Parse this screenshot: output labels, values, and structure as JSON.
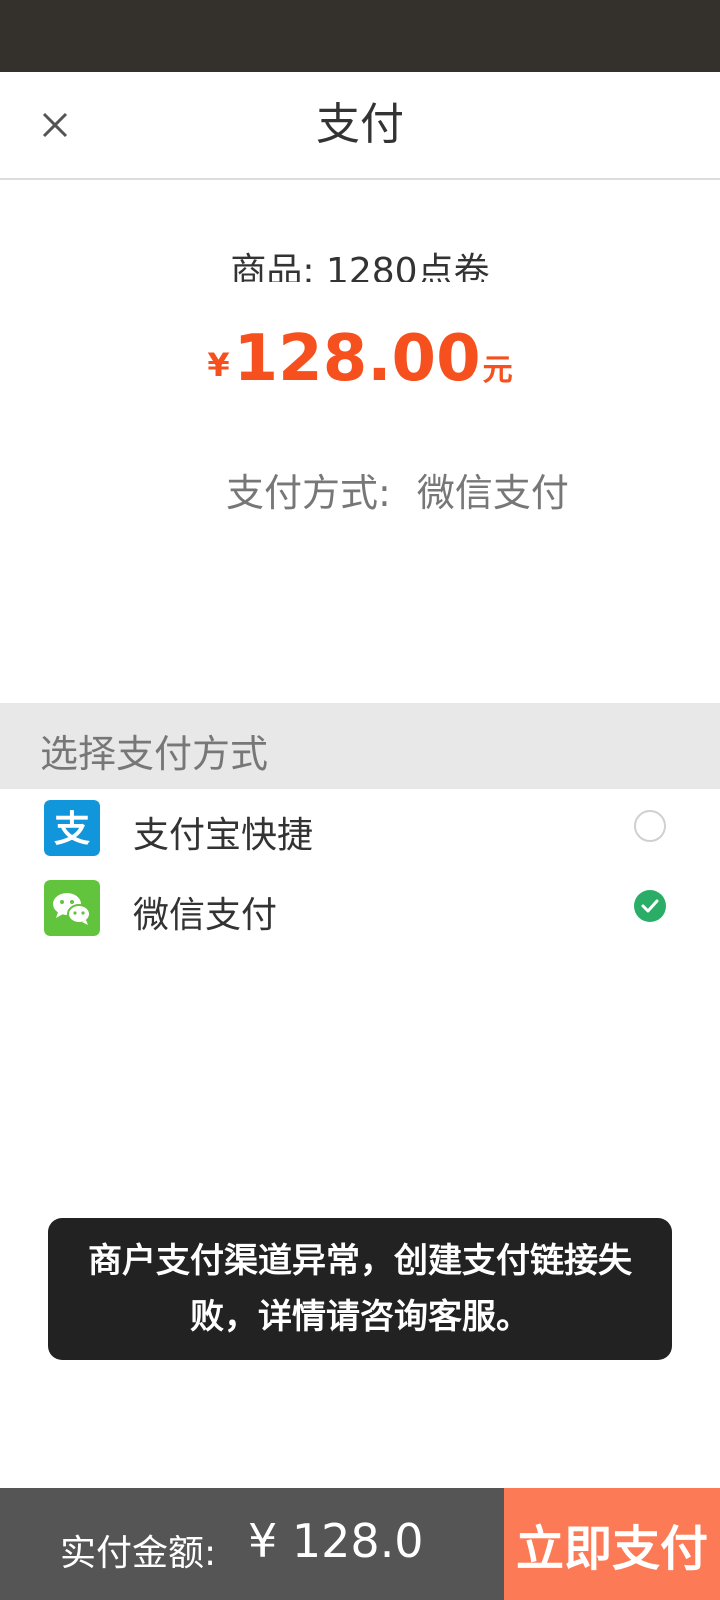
{
  "header": {
    "title": "支付",
    "close_icon": "close-icon"
  },
  "order": {
    "product": "商品: 1280点卷",
    "currency_symbol": "¥",
    "amount": "128.00",
    "unit": "元",
    "method_label": "支付方式:",
    "method_value": "微信支付"
  },
  "payment_section": {
    "title": "选择支付方式",
    "options": [
      {
        "label": "支付宝快捷",
        "icon": "alipay-icon",
        "selected": false,
        "color": "#1296db"
      },
      {
        "label": "微信支付",
        "icon": "wechat-icon",
        "selected": true,
        "color": "#62c33d"
      }
    ]
  },
  "toast": {
    "message": "商户支付渠道异常，创建支付链接失败，详情请咨询客服。"
  },
  "footer": {
    "total_label": "实付金额:",
    "total_value": "¥ 128.0",
    "pay_button": "立即支付"
  },
  "colors": {
    "accent": "#f5501e",
    "pay_button": "#fc7a55",
    "footer": "#555555",
    "selected": "#2aae67"
  }
}
